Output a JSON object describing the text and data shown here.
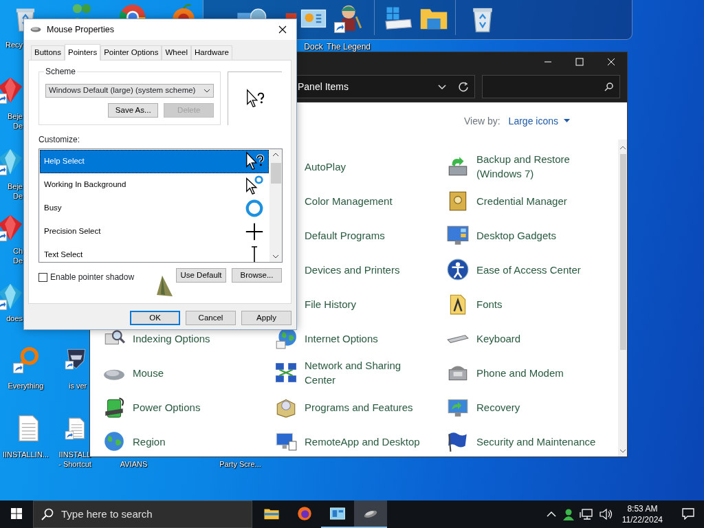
{
  "dock": {
    "items": [
      {
        "kind": "folder-globe"
      },
      {
        "kind": "app-box"
      },
      {
        "kind": "weather",
        "label": "Dock"
      },
      {
        "kind": "figure",
        "label": "The Legend",
        "shortcut": true
      },
      {
        "kind": "drive"
      },
      {
        "kind": "folder"
      },
      {
        "kind": "recycle"
      }
    ]
  },
  "desktop_icons": [
    {
      "kind": "recycle",
      "shortcut": false,
      "lines": [
        "Recy"
      ]
    },
    {
      "kind": "people"
    },
    {
      "kind": "browser"
    },
    {
      "kind": "fruit"
    },
    {
      "kind": "ruby",
      "shortcut": true,
      "lines": [
        "Beje",
        "De"
      ]
    },
    {
      "kind": "diamond",
      "shortcut": true,
      "lines": [
        "Beje",
        "De"
      ]
    },
    {
      "kind": "ruby",
      "shortcut": true,
      "lines": [
        "Ch",
        "De"
      ]
    },
    {
      "kind": "diamond",
      "shortcut": true,
      "lines": [
        "does"
      ]
    },
    {
      "kind": "ring",
      "shortcut": true,
      "lines": [
        "Everything"
      ]
    },
    {
      "kind": "shield",
      "shortcut": true,
      "lines": [
        "is ver"
      ]
    },
    {
      "kind": "document",
      "shortcut": false,
      "lines": [
        "IINSTALLIN..."
      ]
    },
    {
      "kind": "document",
      "shortcut": true,
      "lines": [
        "IINSTALL",
        "- Shortcut"
      ]
    },
    {
      "lines": [
        "AVIANS"
      ]
    },
    {
      "lines": [
        "Party Scre..."
      ]
    }
  ],
  "control_panel": {
    "address": "Panel Items",
    "view_by_label": "View by:",
    "view_by_value": "Large icons",
    "columns": [
      [
        {
          "label": "Indexing Options",
          "kind": "indexing"
        },
        {
          "label": "Mouse",
          "kind": "mouse"
        },
        {
          "label": "Power Options",
          "kind": "power"
        },
        {
          "label": "Region",
          "kind": "region"
        }
      ],
      [
        {
          "label": "AutoPlay"
        },
        {
          "label": "Color Management"
        },
        {
          "label": "Default Programs"
        },
        {
          "label": "Devices and Printers"
        },
        {
          "label": "File History"
        },
        {
          "label": "Internet Options",
          "kind": "internet"
        },
        {
          "label": "Network and Sharing Center",
          "kind": "network"
        },
        {
          "label": "Programs and Features",
          "kind": "programs"
        },
        {
          "label": "RemoteApp and Desktop",
          "kind": "remote"
        }
      ],
      [
        {
          "label": "Backup and Restore (Windows 7)",
          "kind": "backup"
        },
        {
          "label": "Credential Manager",
          "kind": "credential"
        },
        {
          "label": "Desktop Gadgets",
          "kind": "gadgets"
        },
        {
          "label": "Ease of Access Center",
          "kind": "ease"
        },
        {
          "label": "Fonts",
          "kind": "fonts"
        },
        {
          "label": "Keyboard",
          "kind": "keyboard"
        },
        {
          "label": "Phone and Modem",
          "kind": "phone"
        },
        {
          "label": "Recovery",
          "kind": "recovery"
        },
        {
          "label": "Security and Maintenance",
          "kind": "security"
        }
      ]
    ]
  },
  "dialog": {
    "title": "Mouse Properties",
    "tabs": [
      {
        "label": "Buttons",
        "selected": false
      },
      {
        "label": "Pointers",
        "selected": true
      },
      {
        "label": "Pointer Options",
        "selected": false
      },
      {
        "label": "Wheel",
        "selected": false
      },
      {
        "label": "Hardware",
        "selected": false
      }
    ],
    "scheme_label": "Scheme",
    "scheme_value": "Windows Default (large) (system scheme)",
    "scheme_buttons": [
      {
        "label": "Save As...",
        "disabled": false
      },
      {
        "label": "Delete",
        "disabled": true
      }
    ],
    "customize_label": "Customize:",
    "pointers": [
      {
        "label": "Help Select",
        "kind": "help",
        "selected": true
      },
      {
        "label": "Working In Background",
        "kind": "working",
        "selected": false
      },
      {
        "label": "Busy",
        "kind": "busy",
        "selected": false
      },
      {
        "label": "Precision Select",
        "kind": "precision",
        "selected": false
      },
      {
        "label": "Text Select",
        "kind": "text",
        "selected": false
      }
    ],
    "shadow": {
      "label": "Enable pointer shadow",
      "checked": false
    },
    "pointer_buttons": [
      "Use Default",
      "Browse..."
    ],
    "buttons": [
      {
        "label": "OK",
        "default": true
      },
      {
        "label": "Cancel",
        "default": false
      },
      {
        "label": "Apply",
        "default": false
      }
    ]
  },
  "taskbar": {
    "search": {
      "placeholder": "Type here to search"
    },
    "apps": [
      {
        "kind": "folder",
        "open": false,
        "selected": false
      },
      {
        "kind": "browser",
        "open": false,
        "selected": false
      },
      {
        "kind": "panel",
        "open": true,
        "selected": false
      },
      {
        "kind": "mouse",
        "open": true,
        "selected": true
      }
    ],
    "time": "8:53 AM",
    "date": "11/22/2024"
  }
}
